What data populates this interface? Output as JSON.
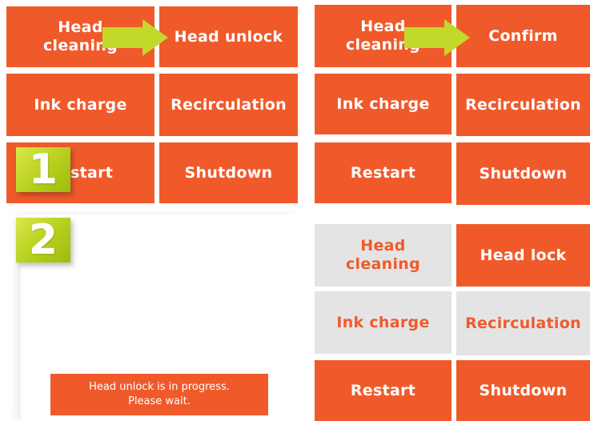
{
  "screen1": {
    "head_cleaning": "Head\ncleaning",
    "head_unlock": "Head unlock",
    "ink_charge": "Ink charge",
    "recirculation": "Recirculation",
    "restart": "Restart",
    "shutdown": "Shutdown"
  },
  "screen2": {
    "head_cleaning": "Head\ncleaning",
    "confirm": "Confirm",
    "ink_charge": "Ink charge",
    "recirculation": "Recirculation",
    "restart": "Restart",
    "shutdown": "Shutdown"
  },
  "screen3": {
    "message": "Head unlock is in progress.\nPlease wait."
  },
  "screen4": {
    "head_cleaning": "Head\ncleaning",
    "head_lock": "Head lock",
    "ink_charge": "Ink charge",
    "recirculation": "Recirculation",
    "restart": "Restart",
    "shutdown": "Shutdown"
  },
  "steps": {
    "step1": "1",
    "step2": "2"
  },
  "colors": {
    "accent": "#f05a2b",
    "disabled_bg": "#e4e4e4",
    "arrow": "#c2d82a",
    "badge": "#b6cf1c"
  },
  "icons": {
    "arrow": "right-arrow-icon"
  }
}
